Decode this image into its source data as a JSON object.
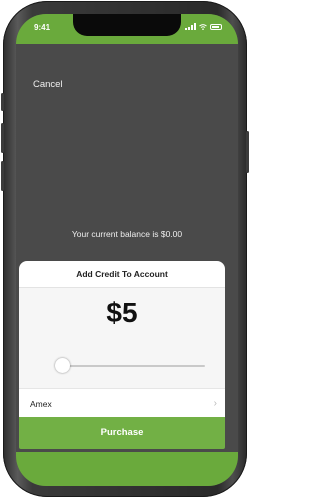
{
  "status_bar": {
    "time": "9:41"
  },
  "nav": {
    "cancel_label": "Cancel"
  },
  "balance": {
    "text": "Your current balance is $0.00"
  },
  "credit_card": {
    "title": "Add Credit To Account",
    "amount": "$5",
    "slider_fraction": 0.0,
    "payment_method": "Amex"
  },
  "purchase": {
    "label": "Purchase"
  },
  "colors": {
    "accent": "#6aaa3c",
    "button": "#72b045",
    "background": "#4a4a4a"
  }
}
